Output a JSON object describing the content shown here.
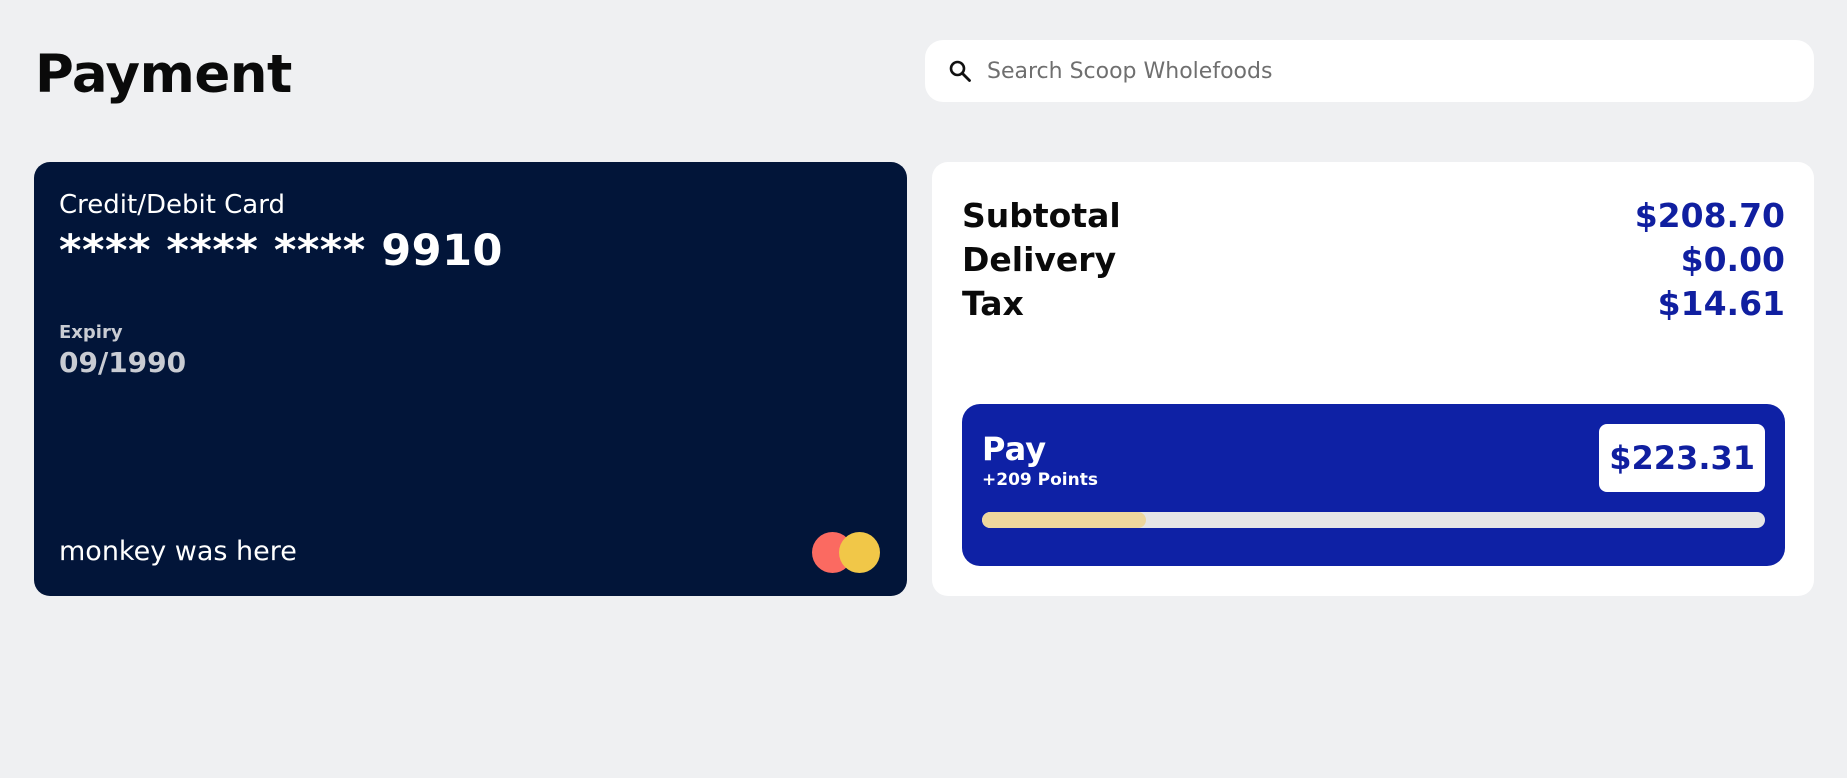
{
  "page": {
    "title": "Payment"
  },
  "search": {
    "placeholder": "Search Scoop Wholefoods",
    "value": "",
    "icon": "search-icon"
  },
  "card": {
    "type_label": "Credit/Debit Card",
    "number": "**** **** **** 9910",
    "expiry_label": "Expiry",
    "expiry_value": "09/1990",
    "holder": "monkey was here",
    "logo_icon": "card-network-logo",
    "colors": {
      "background": "#021539",
      "logo_left": "#fb6a61",
      "logo_right": "#f1c748"
    }
  },
  "summary": {
    "rows": [
      {
        "label": "Subtotal",
        "value": "$208.70"
      },
      {
        "label": "Delivery",
        "value": "$0.00"
      },
      {
        "label": "Tax",
        "value": "$14.61"
      }
    ],
    "pay": {
      "label": "Pay",
      "points": "+209 Points",
      "total": "$223.31",
      "progress_fraction": 0.21
    },
    "colors": {
      "accent": "#0e21a5",
      "value_text": "#101fa0",
      "progress_fill": "#eed79d"
    }
  }
}
